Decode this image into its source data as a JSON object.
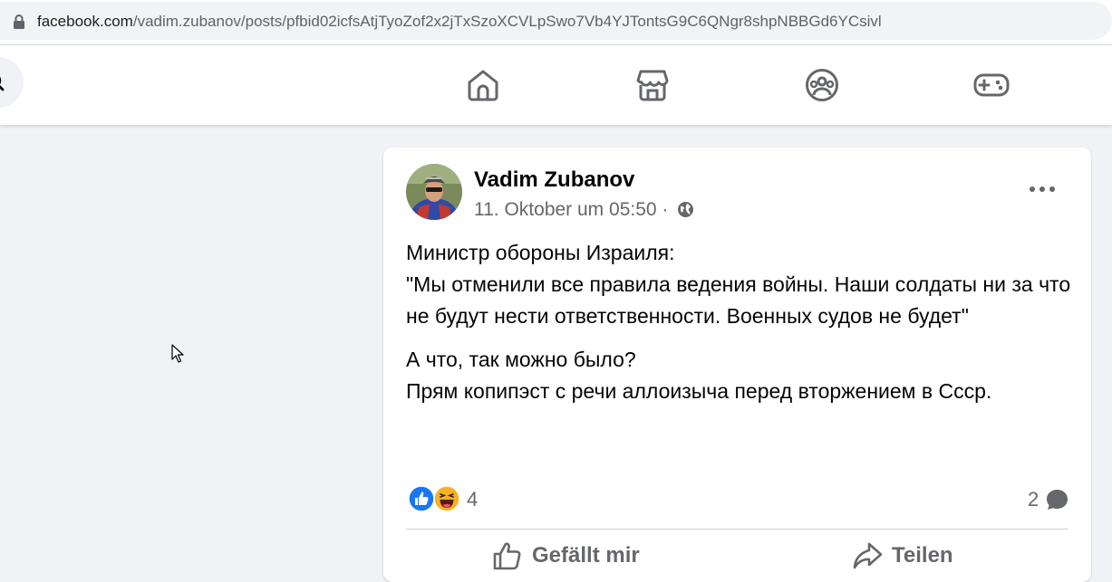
{
  "browser": {
    "url_domain": "facebook.com",
    "url_path": "/vadim.zubanov/posts/pfbid02icfsAtjTyoZof2x2jTxSzoXCVLpSwo7Vb4YJTontsG9C6QNgr8shpNBBGd6YCsivl"
  },
  "nav": {
    "icons": [
      "search-icon",
      "home-icon",
      "marketplace-icon",
      "groups-icon",
      "gaming-icon"
    ]
  },
  "post": {
    "author": "Vadim Zubanov",
    "timestamp": "11. Oktober um 05:50 ·",
    "text_lines": [
      "Министр обороны Израиля:",
      "\"Мы отменили все правила ведения войны. Наши солдаты ни за что не будут нести ответственности. Военных судов не будет\"",
      "А что, так можно было?",
      "Прям копипэст с речи аллоизыча перед вторжением в Ссср."
    ],
    "reaction_count": "4",
    "comment_count": "2",
    "like_label": "Gefällt mir",
    "share_label": "Teilen"
  },
  "colors": {
    "background": "#f0f2f5",
    "card": "#ffffff",
    "secondary_text": "#65676b",
    "like_blue": "#1877f2",
    "haha_yellow": "#f7b125"
  }
}
